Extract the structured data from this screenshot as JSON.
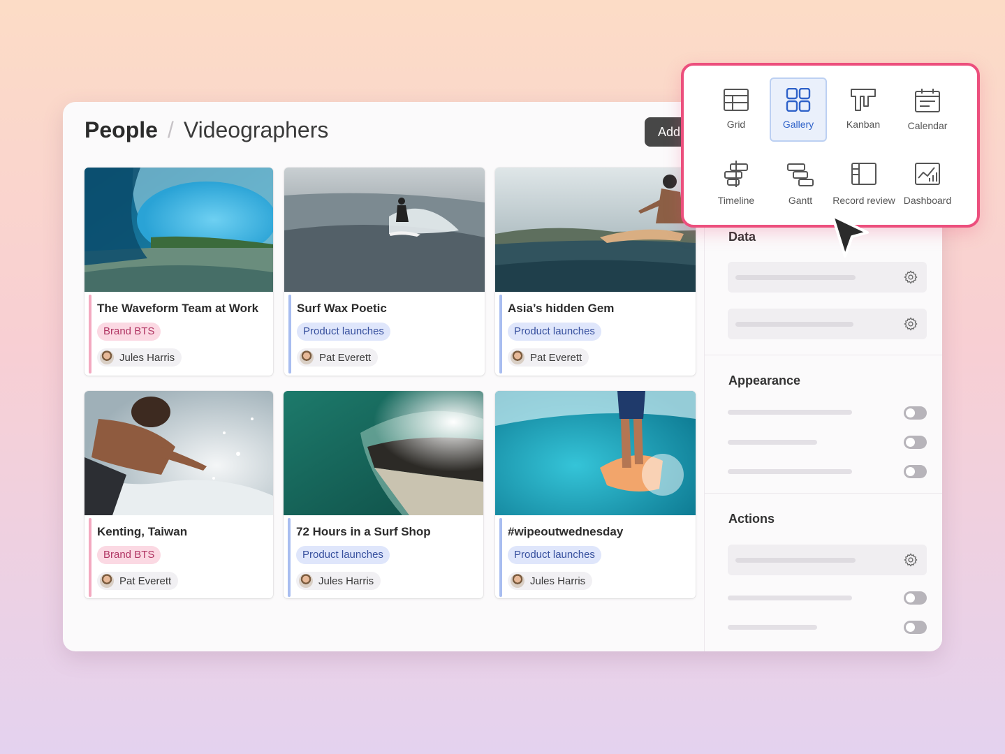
{
  "breadcrumb": {
    "root": "People",
    "separator": "/",
    "current": "Videographers"
  },
  "toolbar": {
    "add_label": "Add"
  },
  "cards": [
    {
      "title": "The Waveform Team at Work",
      "tag": "Brand BTS",
      "person": "Jules Harris"
    },
    {
      "title": "Surf Wax Poetic",
      "tag": "Product launches",
      "person": "Pat Everett"
    },
    {
      "title": "Asia’s hidden Gem",
      "tag": "Product launches",
      "person": "Pat Everett"
    },
    {
      "title": "Kenting, Taiwan",
      "tag": "Brand BTS",
      "person": "Pat Everett"
    },
    {
      "title": "72 Hours in a Surf Shop",
      "tag": "Product launches",
      "person": "Jules Harris"
    },
    {
      "title": "#wipeoutwednesday",
      "tag": "Product launches",
      "person": "Jules Harris"
    }
  ],
  "sidebar": {
    "sections": [
      {
        "title": "Data"
      },
      {
        "title": "Appearance"
      },
      {
        "title": "Actions"
      }
    ]
  },
  "views": {
    "selected": "Gallery",
    "items": [
      {
        "label": "Grid",
        "icon": "grid-icon"
      },
      {
        "label": "Gallery",
        "icon": "gallery-icon"
      },
      {
        "label": "Kanban",
        "icon": "kanban-icon"
      },
      {
        "label": "Calendar",
        "icon": "calendar-icon"
      },
      {
        "label": "Timeline",
        "icon": "timeline-icon"
      },
      {
        "label": "Gantt",
        "icon": "gantt-icon"
      },
      {
        "label": "Record review",
        "icon": "record-review-icon"
      },
      {
        "label": "Dashboard",
        "icon": "dashboard-icon"
      }
    ]
  },
  "colors": {
    "brand_bts_bg": "#fbd9e3",
    "brand_bts_text": "#b03563",
    "brand_bts_accent": "#f3a9c0",
    "product_bg": "#dfe6fb",
    "product_text": "#37509e",
    "product_accent": "#a8bdf0",
    "popup_border": "#ec4f7d",
    "selected_view": "#2f62c9"
  }
}
